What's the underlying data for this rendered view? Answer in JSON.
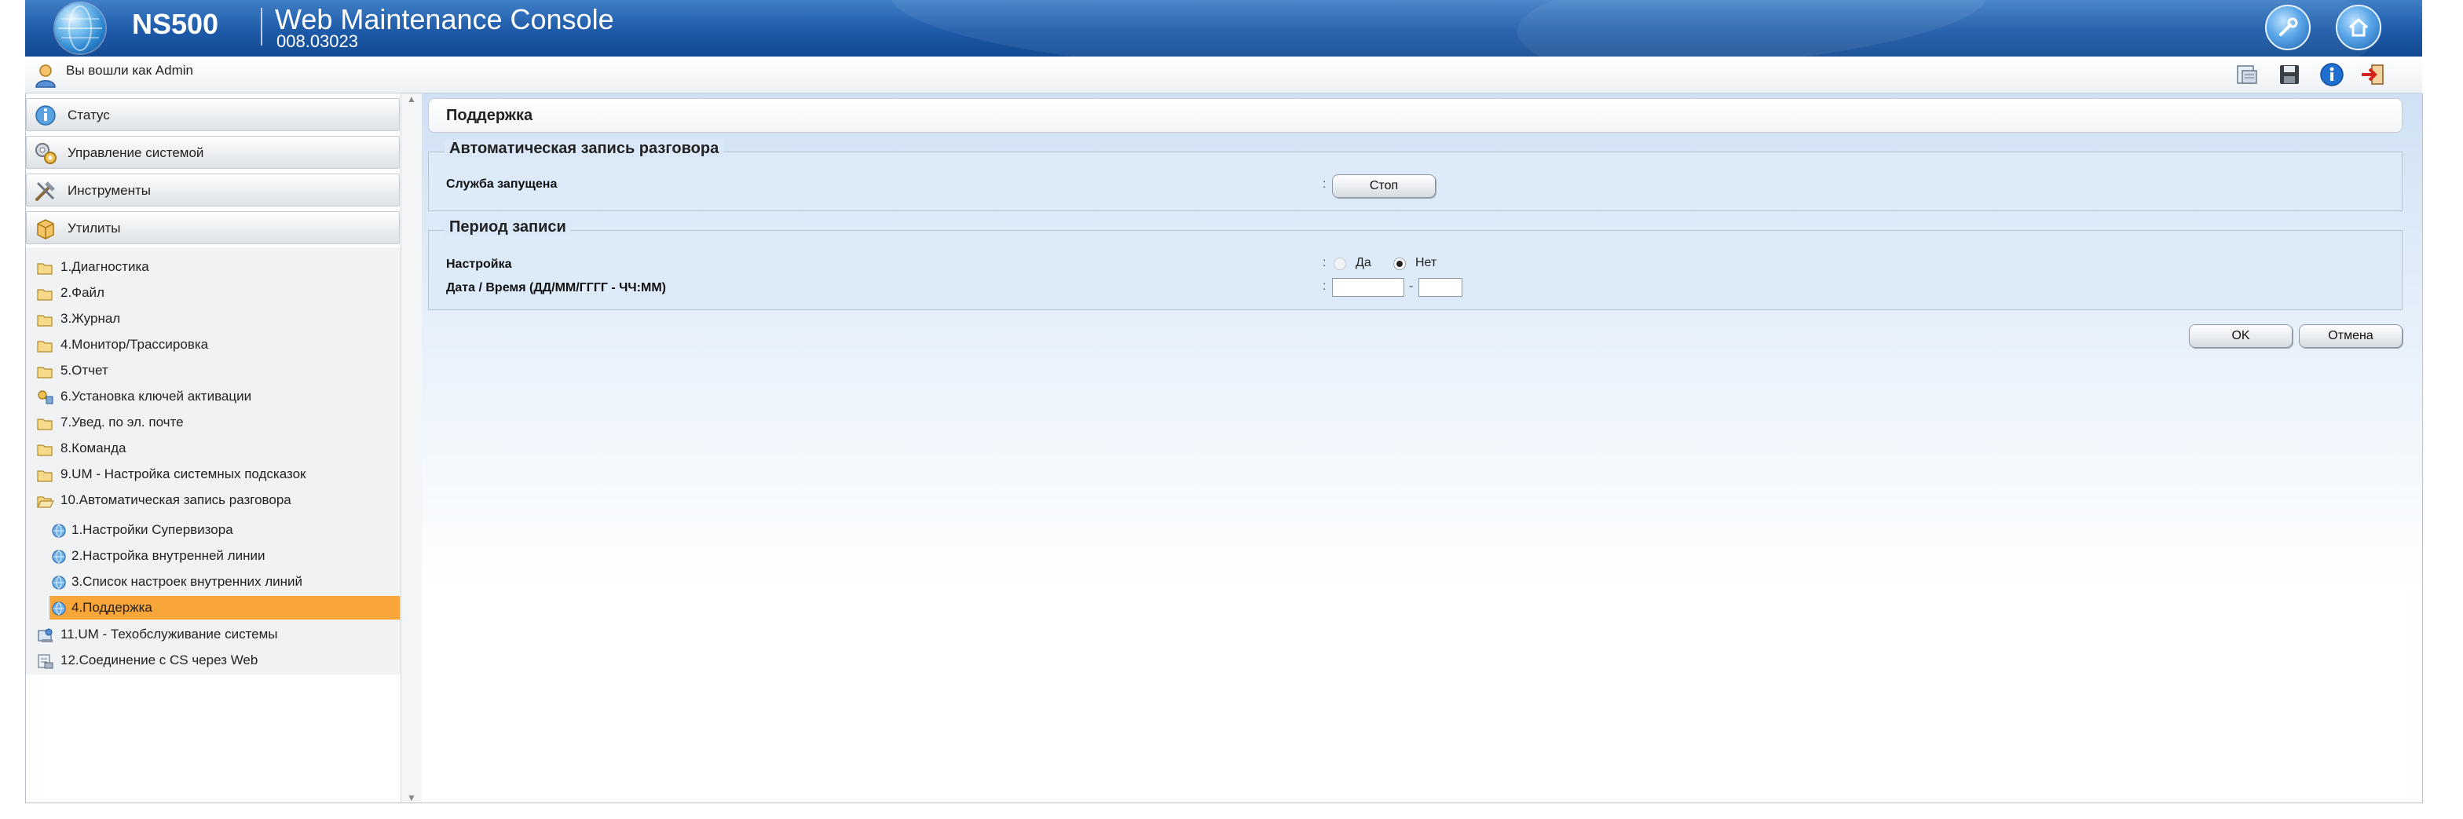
{
  "header": {
    "model": "NS500",
    "title": "Web Maintenance Console",
    "version": "008.03023",
    "buttons": [
      {
        "name": "wrench-icon"
      },
      {
        "name": "home-icon"
      }
    ]
  },
  "userbar": {
    "login_text": "Вы вошли как Admin",
    "icons": [
      "file-transfer-icon",
      "save-icon",
      "info-icon",
      "logout-icon"
    ]
  },
  "sidebar": {
    "categories": [
      {
        "label": "Статус",
        "icon": "status-icon"
      },
      {
        "label": "Управление системой",
        "icon": "system-control-icon"
      },
      {
        "label": "Инструменты",
        "icon": "tools-icon"
      },
      {
        "label": "Утилиты",
        "icon": "utilities-icon"
      }
    ],
    "items": [
      {
        "label": "1.Диагностика",
        "icon": "folder-icon"
      },
      {
        "label": "2.Файл",
        "icon": "folder-icon"
      },
      {
        "label": "3.Журнал",
        "icon": "folder-icon"
      },
      {
        "label": "4.Монитор/Трассировка",
        "icon": "folder-icon"
      },
      {
        "label": "5.Отчет",
        "icon": "folder-icon"
      },
      {
        "label": "6.Установка ключей активации",
        "icon": "key-icon"
      },
      {
        "label": "7.Увед. по эл. почте",
        "icon": "folder-icon"
      },
      {
        "label": "8.Команда",
        "icon": "folder-icon"
      },
      {
        "label": "9.UM - Настройка системных подсказок",
        "icon": "folder-icon"
      },
      {
        "label": "10.Автоматическая запись разговора",
        "icon": "folder-open-icon"
      },
      {
        "label": "1.Настройки Супервизора",
        "icon": "globe-page-icon"
      },
      {
        "label": "2.Настройка внутренней линии",
        "icon": "globe-page-icon"
      },
      {
        "label": "3.Список настроек внутренних линий",
        "icon": "globe-page-icon"
      },
      {
        "label": "4.Поддержка",
        "icon": "globe-page-icon",
        "selected": true
      },
      {
        "label": "11.UM - Техобслуживание системы",
        "icon": "maintenance-icon"
      },
      {
        "label": "12.Соединение с CS через Web",
        "icon": "web-connection-icon"
      }
    ]
  },
  "main": {
    "page_title": "Поддержка",
    "section1": {
      "legend": "Автоматическая запись разговора",
      "service_label": "Служба запущена",
      "stop_button": "Стоп"
    },
    "section2": {
      "legend": "Период записи",
      "setting_label": "Настройка",
      "option_yes": "Да",
      "option_no": "Нет",
      "selected": "Нет",
      "datetime_label": "Дата / Время (ДД/ММ/ГГГГ - ЧЧ:ММ)",
      "date_value": "",
      "time_value": "",
      "separator": "-"
    },
    "ok_button": "OK",
    "cancel_button": "Отмена"
  }
}
